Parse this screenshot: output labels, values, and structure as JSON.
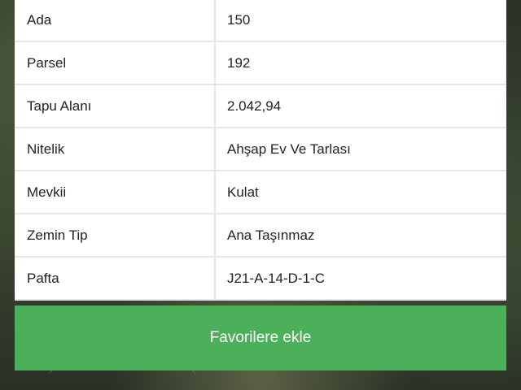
{
  "table": {
    "rows": [
      {
        "label": "Ada",
        "value": "150"
      },
      {
        "label": "Parsel",
        "value": "192"
      },
      {
        "label": "Tapu Alanı",
        "value": "2.042,94"
      },
      {
        "label": "Nitelik",
        "value": "Ahşap Ev Ve Tarlası"
      },
      {
        "label": "Mevkii",
        "value": "Kulat"
      },
      {
        "label": "Zemin Tip",
        "value": "Ana Taşınmaz"
      },
      {
        "label": "Pafta",
        "value": "J21-A-14-D-1-C"
      }
    ]
  },
  "actions": {
    "favorite_label": "Favorilere ekle"
  },
  "colors": {
    "button_green": "#4caf5a",
    "panel_bg": "#ffffff",
    "divider": "#e6e6e6"
  }
}
